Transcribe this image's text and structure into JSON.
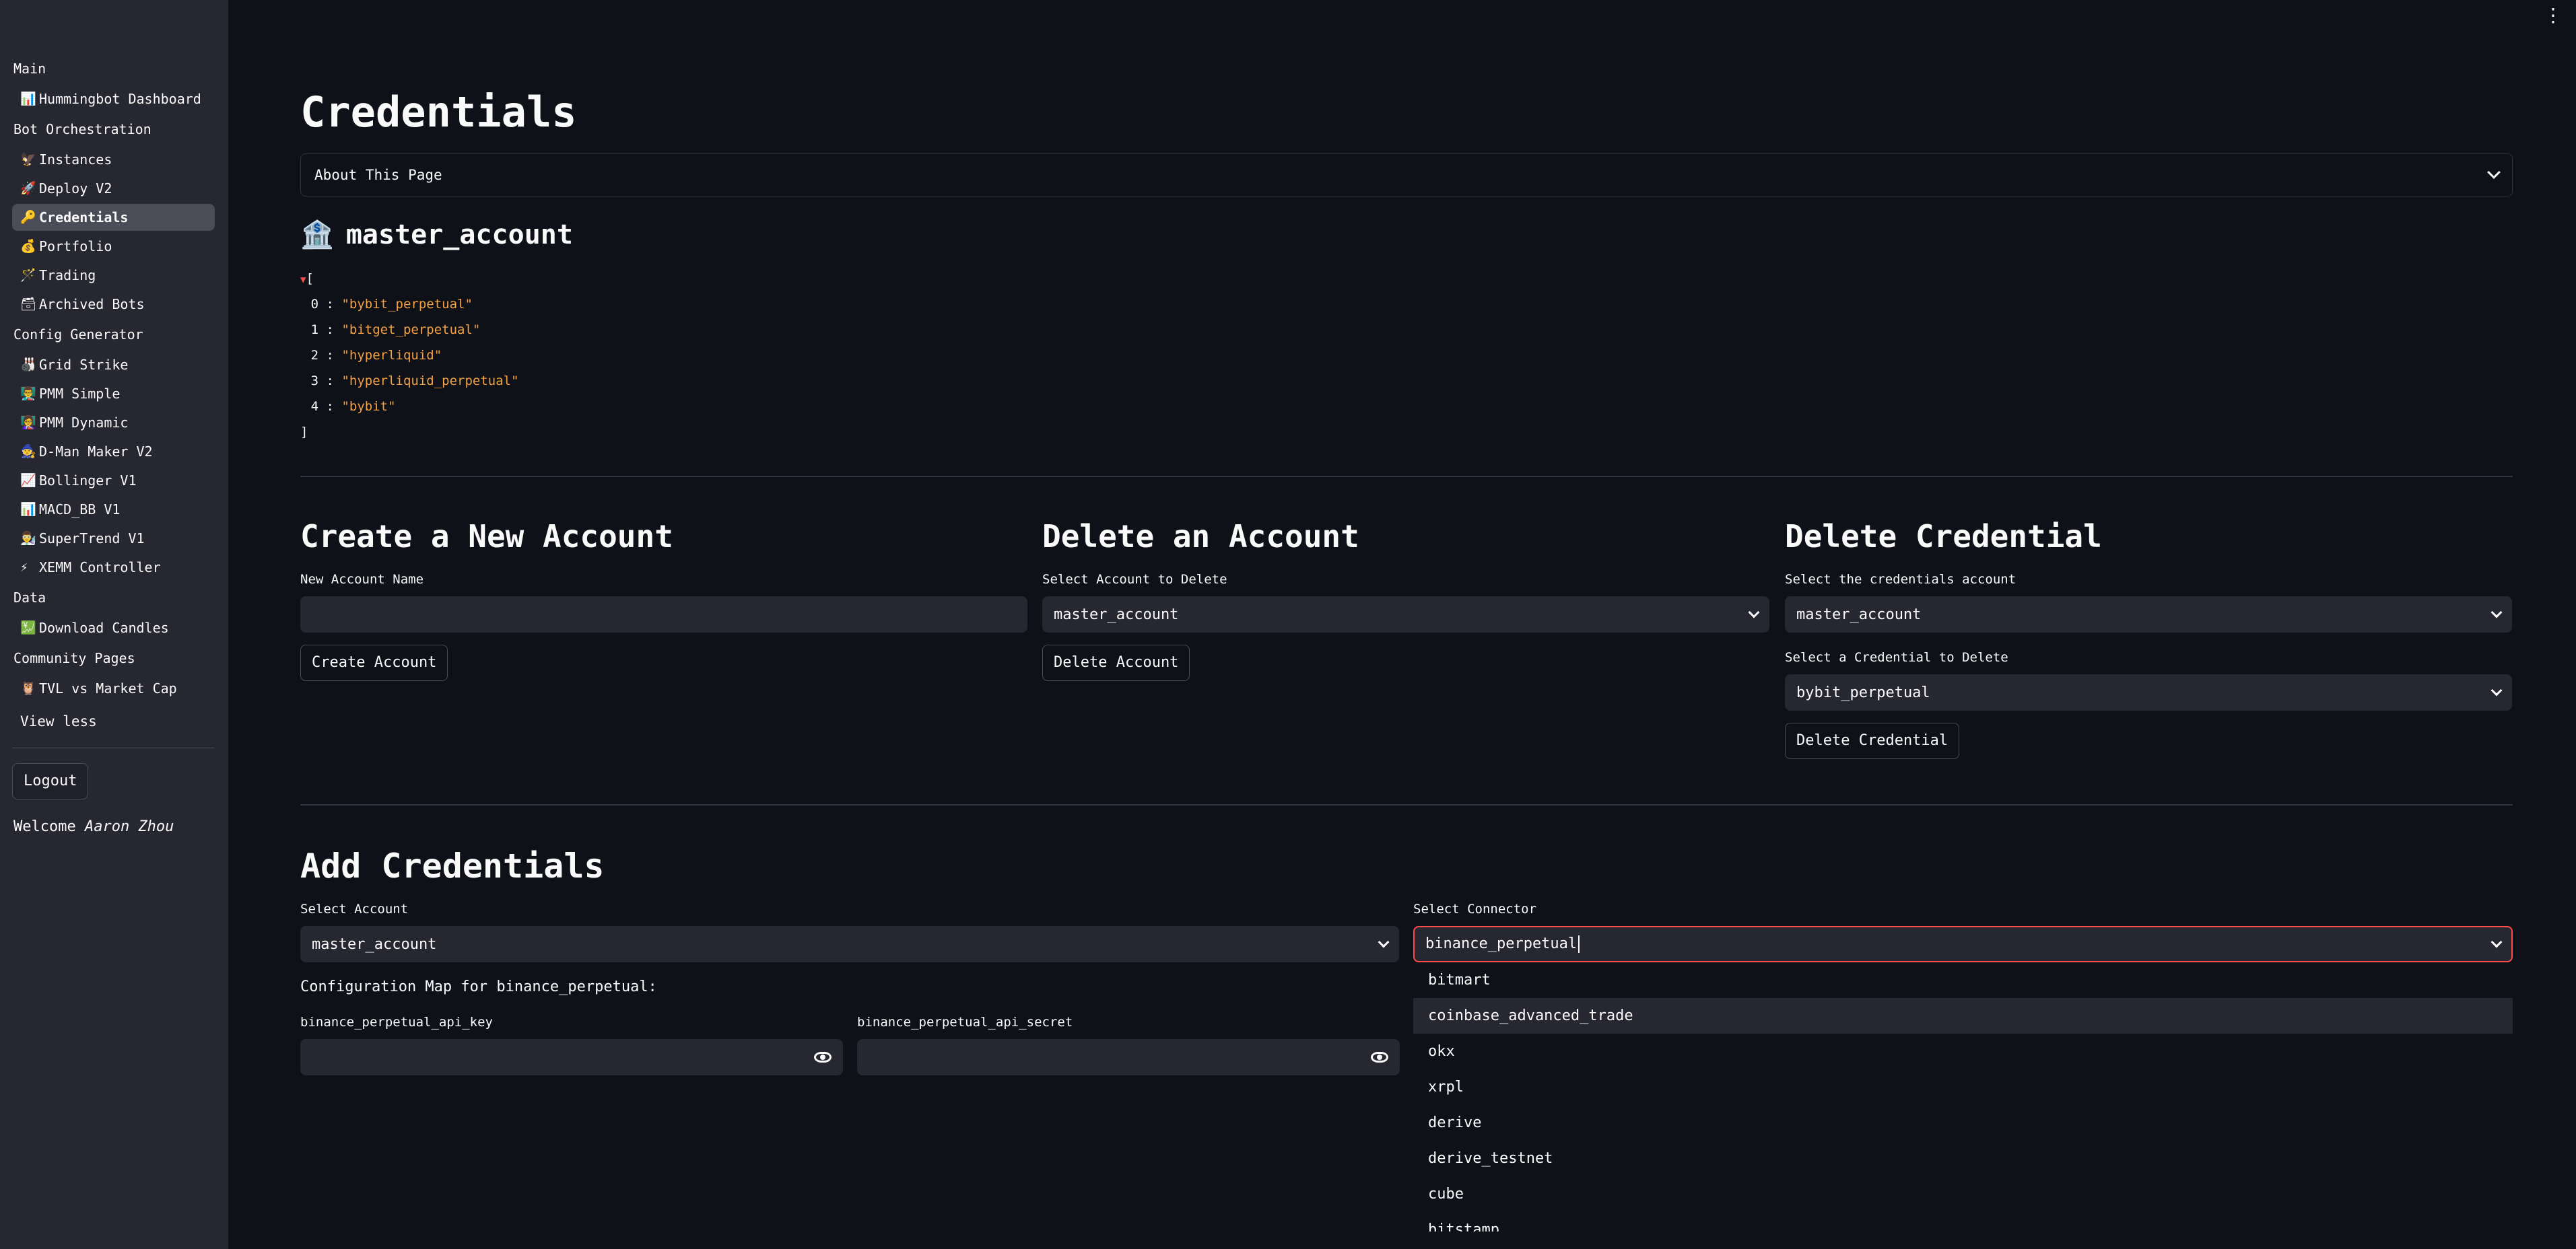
{
  "sidebar": {
    "sections": [
      {
        "title": "Main",
        "items": [
          {
            "icon": "📊",
            "label": "Hummingbot Dashboard"
          }
        ]
      },
      {
        "title": "Bot Orchestration",
        "items": [
          {
            "icon": "🦅",
            "label": "Instances"
          },
          {
            "icon": "🚀",
            "label": "Deploy V2"
          },
          {
            "icon": "🔑",
            "label": "Credentials",
            "active": true
          },
          {
            "icon": "💰",
            "label": "Portfolio"
          },
          {
            "icon": "🪄",
            "label": "Trading"
          },
          {
            "icon": "🗃",
            "label": "Archived Bots"
          }
        ]
      },
      {
        "title": "Config Generator",
        "items": [
          {
            "icon": "🎳",
            "label": "Grid Strike"
          },
          {
            "icon": "👨‍🏫",
            "label": "PMM Simple"
          },
          {
            "icon": "👩‍🏫",
            "label": "PMM Dynamic"
          },
          {
            "icon": "🧙",
            "label": "D-Man Maker V2"
          },
          {
            "icon": "📈",
            "label": "Bollinger V1"
          },
          {
            "icon": "📊",
            "label": "MACD_BB V1"
          },
          {
            "icon": "👨‍🔬",
            "label": "SuperTrend V1"
          },
          {
            "icon": "⚡",
            "label": "XEMM Controller"
          }
        ]
      },
      {
        "title": "Data",
        "items": [
          {
            "icon": "💹",
            "label": "Download Candles"
          }
        ]
      },
      {
        "title": "Community Pages",
        "items": [
          {
            "icon": "🦉",
            "label": "TVL vs Market Cap"
          }
        ]
      }
    ],
    "view_less": "View less",
    "logout": "Logout",
    "welcome_prefix": "Welcome",
    "welcome_user": "Aaron Zhou"
  },
  "main": {
    "title": "Credentials",
    "about": "About This Page",
    "account_icon": "🏦",
    "account_name": "master_account",
    "credentials": [
      "\"bybit_perpetual\"",
      "\"bitget_perpetual\"",
      "\"hyperliquid\"",
      "\"hyperliquid_perpetual\"",
      "\"bybit\""
    ],
    "create": {
      "title": "Create a New Account",
      "label": "New Account Name",
      "value": "",
      "button": "Create Account"
    },
    "delete_account": {
      "title": "Delete an Account",
      "label": "Select Account to Delete",
      "value": "master_account",
      "button": "Delete Account"
    },
    "delete_credential": {
      "title": "Delete Credential",
      "account_label": "Select the credentials account",
      "account_value": "master_account",
      "cred_label": "Select a Credential to Delete",
      "cred_value": "bybit_perpetual",
      "button": "Delete Credential"
    },
    "add": {
      "title": "Add Credentials",
      "account_label": "Select Account",
      "account_value": "master_account",
      "connector_label": "Select Connector",
      "connector_value": "binance_perpetual",
      "config_map": "Configuration Map for binance_perpetual:",
      "api_key_label": "binance_perpetual_api_key",
      "api_secret_label": "binance_perpetual_api_secret"
    },
    "connector_options": [
      "bitmart",
      "coinbase_advanced_trade",
      "okx",
      "xrpl",
      "derive",
      "derive_testnet",
      "cube",
      "bitstamp"
    ]
  },
  "colors": {
    "background": "#0e1117",
    "sidebar": "#262730",
    "focus": "#ff4b4b",
    "json_string": "#f5a142"
  }
}
